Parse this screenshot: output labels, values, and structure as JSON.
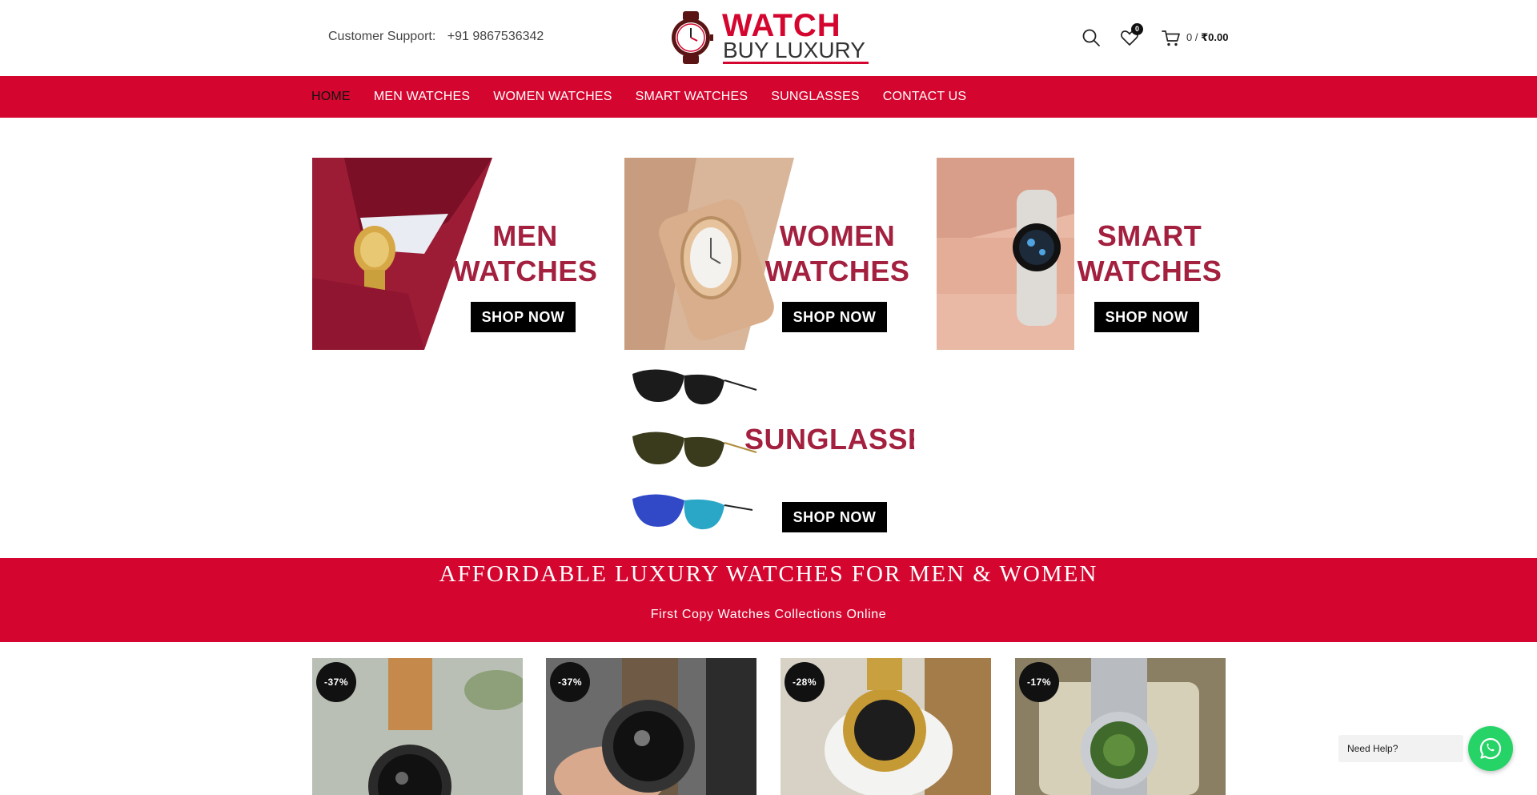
{
  "header": {
    "support_label": "Customer Support:",
    "support_phone": "+91 9867536342",
    "logo_top": "WATCH",
    "logo_bottom": "BUY LUXURY",
    "wishlist_count": "0",
    "cart_count": "0 /",
    "cart_amount": "₹0.00",
    "icons": [
      "search-icon",
      "heart-icon",
      "cart-icon"
    ]
  },
  "nav": {
    "items": [
      "HOME",
      "MEN WATCHES",
      "WOMEN WATCHES",
      "SMART WATCHES",
      "SUNGLASSES",
      "CONTACT US"
    ],
    "active": "HOME"
  },
  "categories": [
    {
      "line1": "MEN",
      "line2": "WATCHES",
      "cta": "SHOP NOW"
    },
    {
      "line1": "WOMEN",
      "line2": "WATCHES",
      "cta": "SHOP NOW"
    },
    {
      "line1": "SMART",
      "line2": "WATCHES",
      "cta": "SHOP NOW"
    },
    {
      "line1": "SUNGLASSES",
      "cta": "SHOP NOW"
    }
  ],
  "promo": {
    "headline": "AFFORDABLE LUXURY WATCHES FOR MEN & WOMEN",
    "subline": "First Copy Watches Collections Online"
  },
  "products": [
    {
      "discount": "-37%"
    },
    {
      "discount": "-37%"
    },
    {
      "discount": "-28%"
    },
    {
      "discount": "-17%"
    }
  ],
  "help": {
    "label": "Need Help?",
    "icon": "whatsapp-icon"
  },
  "colors": {
    "brand_red": "#d4062f",
    "title_maroon": "#a3203f",
    "whatsapp_green": "#25d366"
  }
}
